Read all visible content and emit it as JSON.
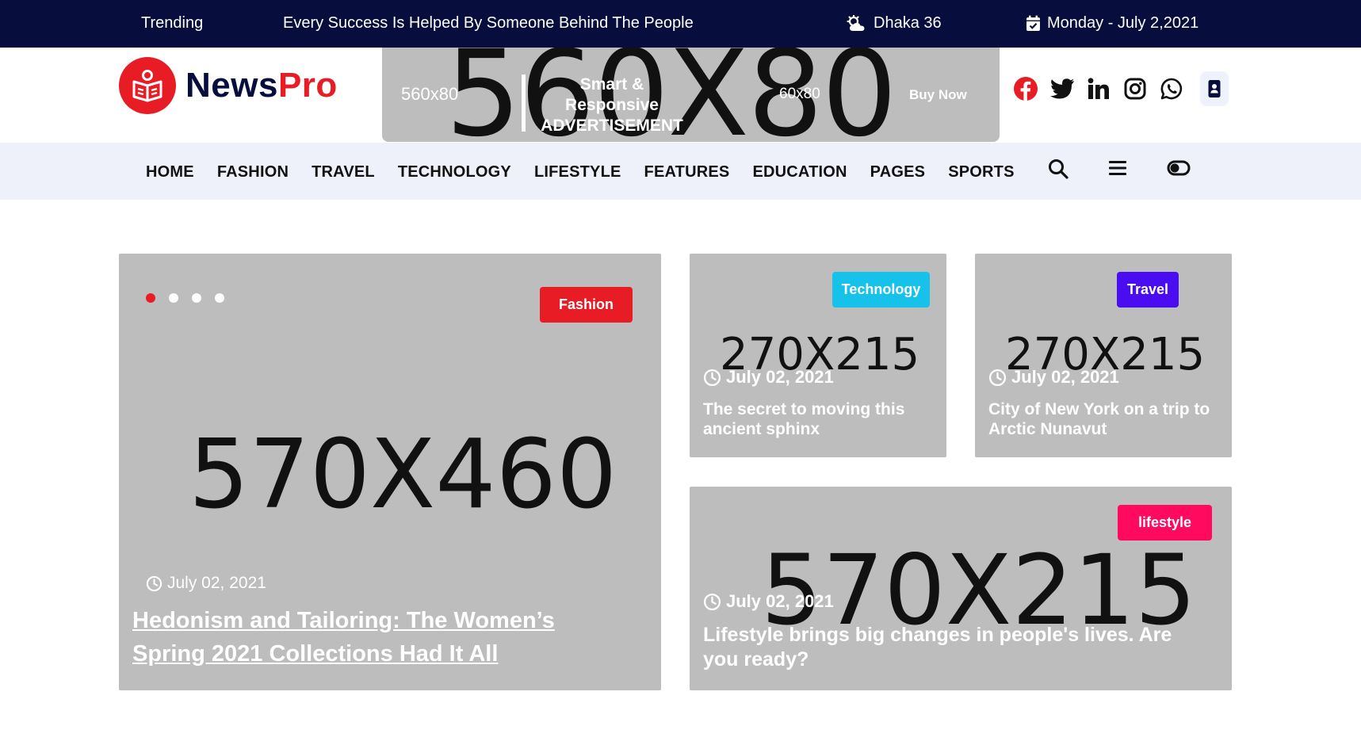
{
  "topbar": {
    "trending_label": "Trending",
    "headline": "Every Success Is Helped By Someone Behind The People",
    "weather": "Dhaka 36",
    "date": "Monday - July 2,2021"
  },
  "header": {
    "logo_news": "News",
    "logo_pro": "Pro",
    "ad": {
      "placeholder": "560X80",
      "size_label": "560x80",
      "title_line1": "Smart & Responsive",
      "title_line2": "ADVERTISEMENT",
      "size_label_2": "60x80",
      "buy_now": "Buy Now"
    }
  },
  "nav": {
    "items": [
      "HOME",
      "FASHION",
      "TRAVEL",
      "TECHNOLOGY",
      "LIFESTYLE",
      "FEATURES",
      "EDUCATION",
      "PAGES",
      "SPORTS"
    ]
  },
  "colors": {
    "topbar_bg": "#070d3c",
    "brand_red": "#e81c24",
    "nav_bg": "#eef1fa",
    "placeholder_bg": "#bdbdbd",
    "badge_fashion": "#e81c24",
    "badge_technology": "#16c1ea",
    "badge_travel": "#4a0df2",
    "badge_lifestyle": "#ff0a5e"
  },
  "cards": {
    "main": {
      "placeholder": "570X460",
      "category": "Fashion",
      "date": "July 02, 2021",
      "title": "Hedonism and Tailoring: The Women’s Spring 2021 Collections Had It All",
      "slides": 4,
      "active_slide": 1
    },
    "tech": {
      "placeholder": "270X215",
      "category": "Technology",
      "date": "July 02, 2021",
      "title": "The secret to moving this ancient sphinx"
    },
    "travel": {
      "placeholder": "270X215",
      "category": "Travel",
      "date": "July 02, 2021",
      "title": "City of New York on a trip to Arctic Nunavut"
    },
    "lifestyle": {
      "placeholder": "570X215",
      "category": "lifestyle",
      "date": "July 02, 2021",
      "title": "Lifestyle brings big changes in people's lives. Are you ready?"
    }
  },
  "icons": [
    "weather-icon",
    "calendar-icon",
    "facebook-icon",
    "twitter-icon",
    "linkedin-icon",
    "instagram-icon",
    "whatsapp-icon",
    "contact-icon",
    "search-icon",
    "menu-icon",
    "toggle-icon",
    "clock-icon"
  ]
}
